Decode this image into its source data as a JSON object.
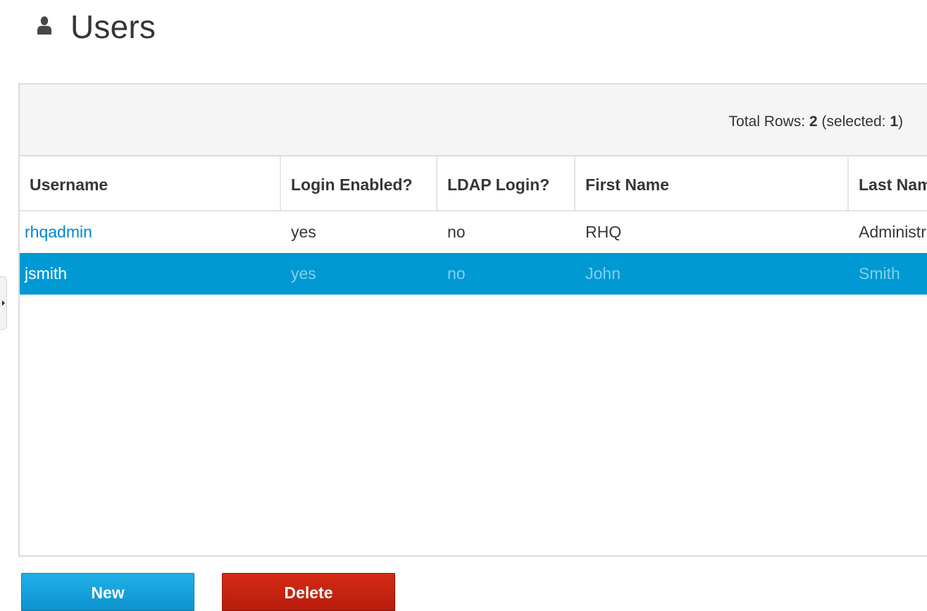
{
  "page": {
    "title": "Users",
    "title_icon": "user-icon"
  },
  "table": {
    "row_count": {
      "prefix": "Total Rows: ",
      "total": "2",
      "middle": " (selected: ",
      "selected": "1",
      "suffix": ")"
    },
    "columns": [
      {
        "label": "Username"
      },
      {
        "label": "Login Enabled?"
      },
      {
        "label": "LDAP Login?"
      },
      {
        "label": "First Name"
      },
      {
        "label": "Last Name"
      }
    ],
    "rows": [
      {
        "username": "rhqadmin",
        "login_enabled": "yes",
        "ldap_login": "no",
        "first_name": "RHQ",
        "last_name": "Administrator",
        "selected": false
      },
      {
        "username": "jsmith",
        "login_enabled": "yes",
        "ldap_login": "no",
        "first_name": "John",
        "last_name": "Smith",
        "selected": true
      }
    ]
  },
  "buttons": {
    "new_label": "New",
    "delete_label": "Delete"
  },
  "colors": {
    "link": "#0085cf",
    "selection": "#0099d3",
    "new_button": "#0c93cf",
    "delete_button": "#c4220f"
  }
}
